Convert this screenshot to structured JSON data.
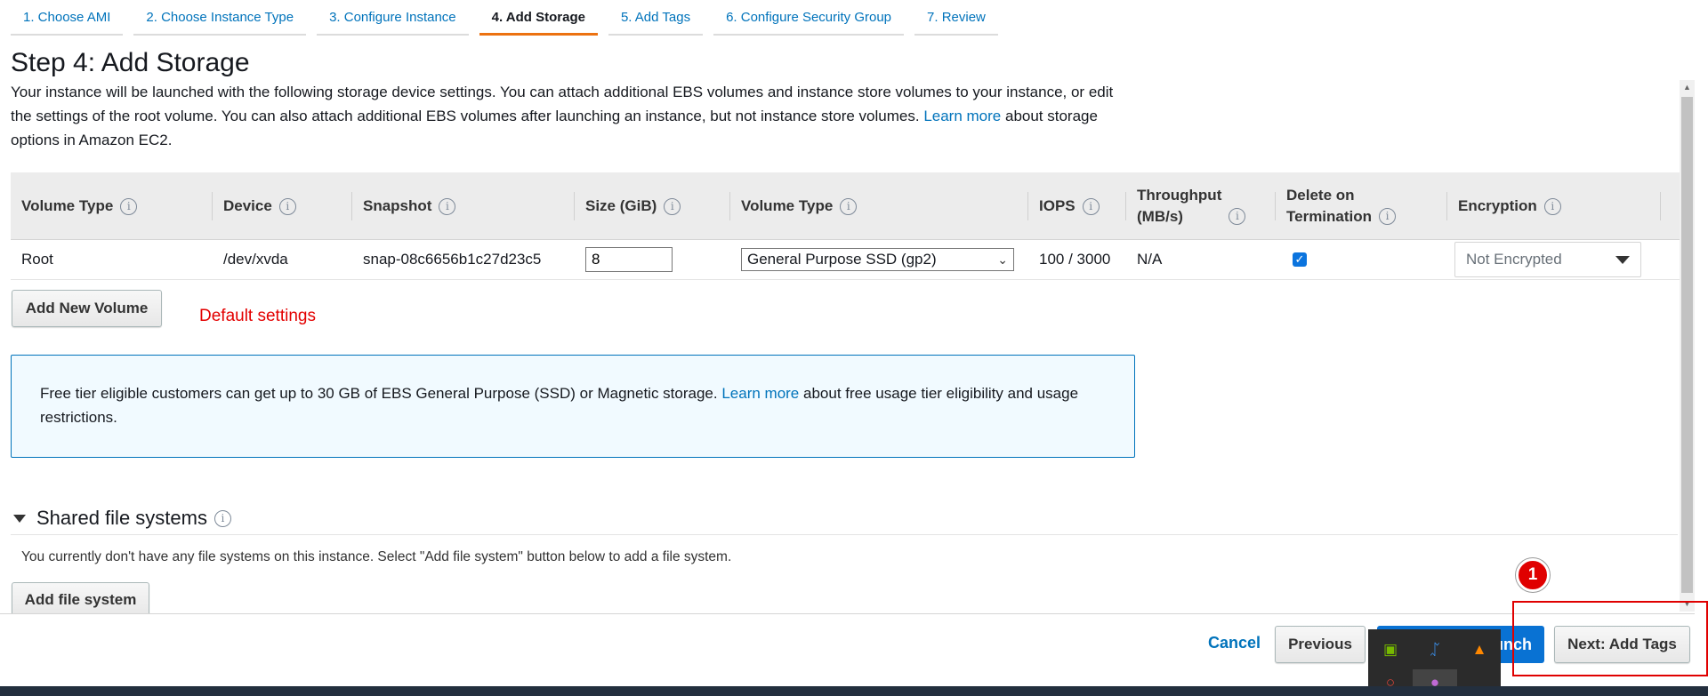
{
  "tabs": [
    {
      "label": "1. Choose AMI",
      "active": false
    },
    {
      "label": "2. Choose Instance Type",
      "active": false
    },
    {
      "label": "3. Configure Instance",
      "active": false
    },
    {
      "label": "4. Add Storage",
      "active": true
    },
    {
      "label": "5. Add Tags",
      "active": false
    },
    {
      "label": "6. Configure Security Group",
      "active": false
    },
    {
      "label": "7. Review",
      "active": false
    }
  ],
  "page": {
    "title": "Step 4: Add Storage",
    "intro_text": "Your instance will be launched with the following storage device settings. You can attach additional EBS volumes and instance store volumes to your instance, or edit the settings of the root volume. You can also attach additional EBS volumes after launching an instance, but not instance store volumes.",
    "intro_link": "Learn more",
    "intro_suffix": "about storage options in Amazon EC2."
  },
  "table": {
    "headers": [
      "Volume Type",
      "Device",
      "Snapshot",
      "Size (GiB)",
      "Volume Type",
      "IOPS",
      "Throughput (MB/s)",
      "Delete on Termination",
      "Encryption"
    ],
    "headers_wrapped": {
      "throughput_line1": "Throughput",
      "throughput_line2": "(MB/s)",
      "delete_line1": "Delete on",
      "delete_line2": "Termination"
    },
    "rows": [
      {
        "volume_type": "Root",
        "device": "/dev/xvda",
        "snapshot": "snap-08c6656b1c27d23c5",
        "size": "8",
        "ebs_type": "General Purpose SSD (gp2)",
        "iops": "100 / 3000",
        "throughput": "N/A",
        "delete_on_termination": true,
        "encryption": "Not Encrypted"
      }
    ]
  },
  "add_volume_label": "Add New Volume",
  "annotation_note": "Default settings",
  "notice": {
    "text": "Free tier eligible customers can get up to 30 GB of EBS General Purpose (SSD) or Magnetic storage.",
    "link": "Learn more",
    "suffix": "about free usage tier eligibility and usage restrictions."
  },
  "shared_fs": {
    "title": "Shared file systems",
    "empty_text": "You currently don't have any file systems on this instance. Select \"Add file system\" button below to add a file system.",
    "add_label": "Add file system"
  },
  "footer": {
    "cancel": "Cancel",
    "previous": "Previous",
    "review_launch_visible": "unch",
    "next": "Next: Add Tags"
  },
  "annotation_badge": "1",
  "colors": {
    "link": "#0073bb",
    "active_tab": "#ec7211",
    "primary": "#0972d3",
    "annotation": "#e00000"
  }
}
